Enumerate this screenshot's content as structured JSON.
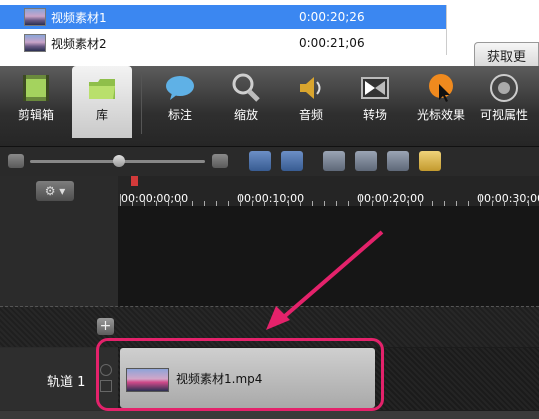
{
  "clips": [
    {
      "name": "视频素材1",
      "duration": "0:00:20;26",
      "selected": true
    },
    {
      "name": "视频素材2",
      "duration": "0:00:21;06",
      "selected": false
    }
  ],
  "get_tab": "获取更",
  "toolbar": {
    "items": [
      {
        "label": "剪辑箱",
        "icon": "film-icon",
        "active": false
      },
      {
        "label": "库",
        "icon": "folder-icon",
        "active": true
      },
      {
        "label": "标注",
        "icon": "speech-bubble-icon",
        "active": false
      },
      {
        "label": "缩放",
        "icon": "magnifier-icon",
        "active": false
      },
      {
        "label": "音频",
        "icon": "speaker-icon",
        "active": false
      },
      {
        "label": "转场",
        "icon": "transition-icon",
        "active": false
      },
      {
        "label": "光标效果",
        "icon": "cursor-effect-icon",
        "active": false
      },
      {
        "label": "可视属性",
        "icon": "visual-properties-icon",
        "active": false
      }
    ]
  },
  "ruler": {
    "labels": [
      "00:00:00;00",
      "00:00:10;00",
      "00:00:20;00",
      "00:00:30;00"
    ]
  },
  "track": {
    "label": "轨道 1",
    "clip_name": "视频素材1.mp4"
  },
  "colors": {
    "selection": "#3b87f1",
    "highlight": "#e4226b",
    "toolbar_bg": "#2f2f2f"
  }
}
